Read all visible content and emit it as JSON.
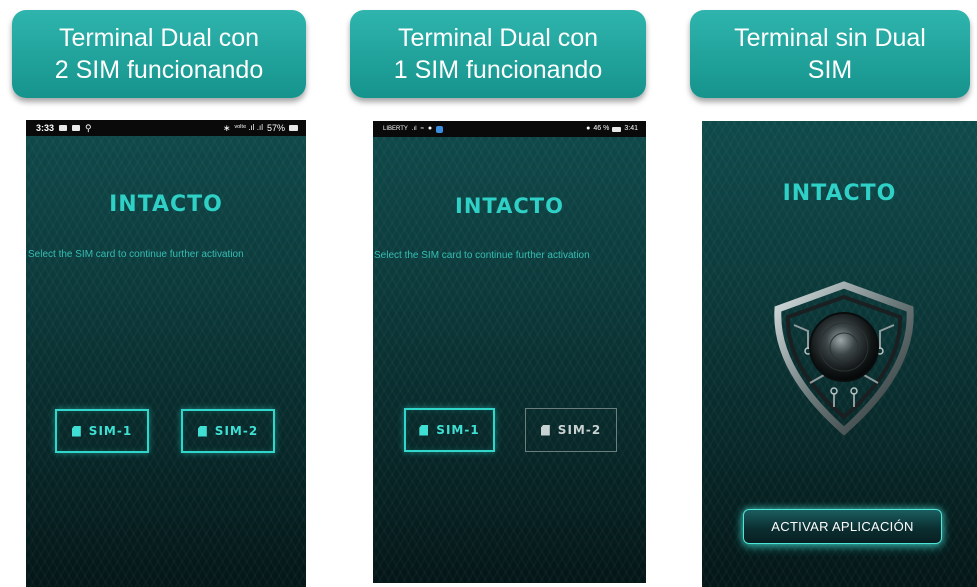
{
  "headers": [
    {
      "line1": "Terminal Dual con",
      "line2": "2 SIM funcionando"
    },
    {
      "line1": "Terminal Dual con",
      "line2": "1 SIM funcionando"
    },
    {
      "line1": "Terminal sin Dual",
      "line2": "SIM"
    }
  ],
  "screen1": {
    "status": {
      "time": "3:33",
      "battery": "57%",
      "signal": "ᵛᵒˡᵗᵉ .ıl .ıl"
    },
    "title": "INTACTO",
    "instruction": "Select the SIM card to continue further activation",
    "sim1": "SIM-1",
    "sim2": "SIM-2"
  },
  "screen2": {
    "status": {
      "carrier": "LIBERTY",
      "battery": "46 %",
      "time": "3:41"
    },
    "title": "INTACTO",
    "instruction": "Select the SIM card to continue further activation",
    "sim1": "SIM-1",
    "sim2": "SIM-2"
  },
  "screen3": {
    "title": "INTACTO",
    "activate": "ACTIVAR APLICACIÓN"
  },
  "colors": {
    "header_bg": "#1ba39c",
    "accent": "#2fd6c9",
    "screen_dark": "#082a2b"
  }
}
